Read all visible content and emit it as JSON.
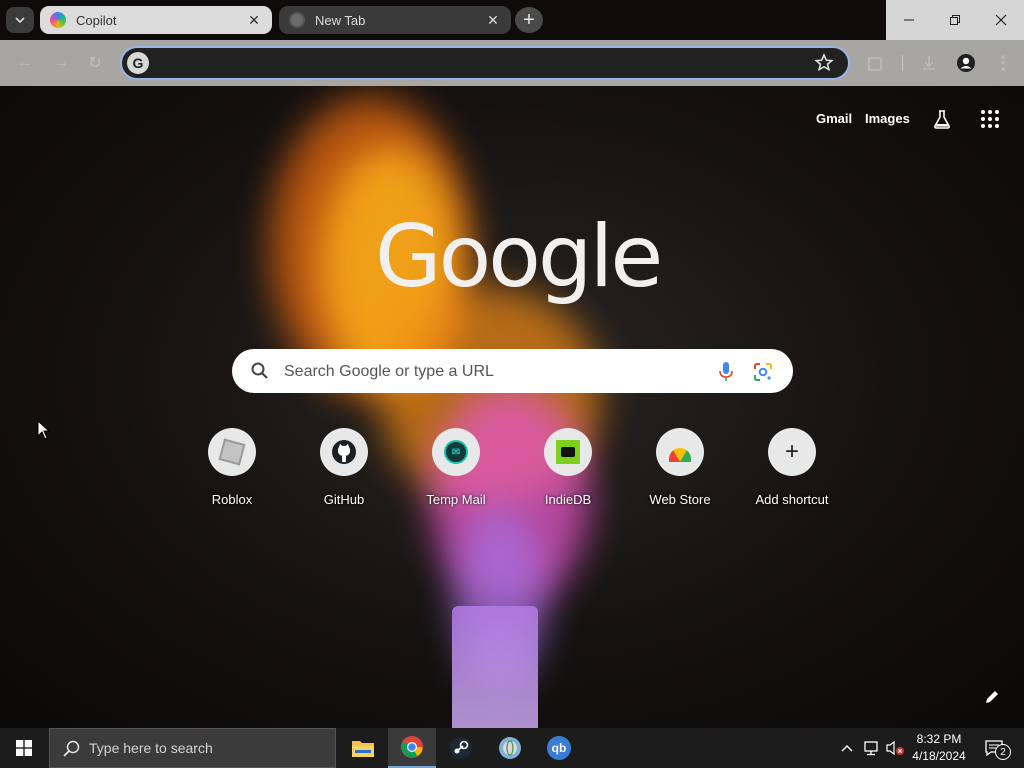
{
  "tabs": [
    {
      "label": "Copilot",
      "active": true
    },
    {
      "label": "New Tab",
      "active": false
    }
  ],
  "new_tab_symbol": "+",
  "window_controls": {
    "minimize": "minimize-icon",
    "restore": "restore-icon",
    "close": "close-icon"
  },
  "omnibox": {
    "value": "",
    "placeholder": "",
    "provider_icon": "G"
  },
  "top_links": {
    "gmail": "Gmail",
    "images": "Images"
  },
  "logo": "Google",
  "search": {
    "placeholder": "Search Google or type a URL"
  },
  "shortcuts": [
    {
      "name": "Roblox",
      "icon": "roblox-icon"
    },
    {
      "name": "GitHub",
      "icon": "github-icon"
    },
    {
      "name": "Temp Mail",
      "icon": "tempmail-icon"
    },
    {
      "name": "IndieDB",
      "icon": "indiedb-icon"
    },
    {
      "name": "Web Store",
      "icon": "webstore-icon"
    },
    {
      "name": "Add shortcut",
      "icon": "plus-icon",
      "symbol": "+"
    }
  ],
  "taskbar": {
    "search_placeholder": "Type here to search",
    "apps": [
      "file-explorer-icon",
      "chrome-icon",
      "steam-icon",
      "app-globe-icon",
      "qbittorrent-icon"
    ],
    "qb_label": "qb",
    "time": "8:32 PM",
    "date": "4/18/2024",
    "notification_count": "2"
  },
  "colors": {
    "omnibox_focus": "#9ab4e6",
    "taskbar": "#1c1c1c",
    "titlebar": "#0f0b0a"
  }
}
